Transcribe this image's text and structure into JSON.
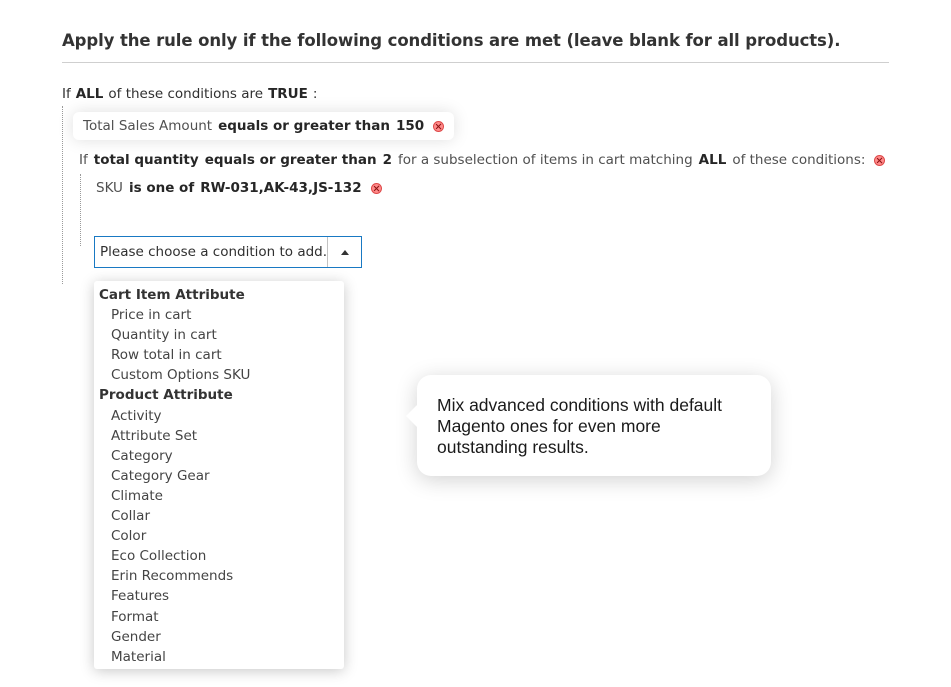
{
  "section": {
    "heading": "Apply the rule only if the following conditions are met (leave blank for all products)."
  },
  "root_condition": {
    "prefix": "If",
    "aggregator": "ALL",
    "middle": "of these conditions are",
    "value": "TRUE",
    "suffix": ":"
  },
  "condition_1": {
    "attribute": "Total Sales Amount",
    "operator": "equals or greater than",
    "value": "150"
  },
  "condition_2": {
    "prefix": "If",
    "attribute": "total quantity",
    "operator": "equals or greater than",
    "value": "2",
    "middle": "for a subselection of items in cart matching",
    "aggregator": "ALL",
    "suffix": "of these conditions:"
  },
  "condition_3": {
    "attribute": "SKU",
    "operator": "is one of",
    "value": "RW-031,AK-43,JS-132"
  },
  "select": {
    "placeholder": "Please choose a condition to add."
  },
  "dropdown": {
    "groups": [
      {
        "label": "Cart Item Attribute",
        "options": [
          "Price in cart",
          "Quantity in cart",
          "Row total in cart",
          "Custom Options SKU"
        ]
      },
      {
        "label": "Product Attribute",
        "options": [
          "Activity",
          "Attribute Set",
          "Category",
          "Category Gear",
          "Climate",
          "Collar",
          "Color",
          "Eco Collection",
          "Erin Recommends",
          "Features",
          "Format",
          "Gender",
          "Material"
        ]
      }
    ]
  },
  "tooltip": {
    "text": "Mix advanced conditions with default Magento ones for even more outstanding results."
  },
  "colors": {
    "select_border": "#1979c3",
    "remove_icon": "#ff8a8a",
    "divider": "#cfcfcf"
  },
  "icons": {
    "remove": "remove-condition-icon",
    "dropdown": "chevron-up-icon"
  }
}
